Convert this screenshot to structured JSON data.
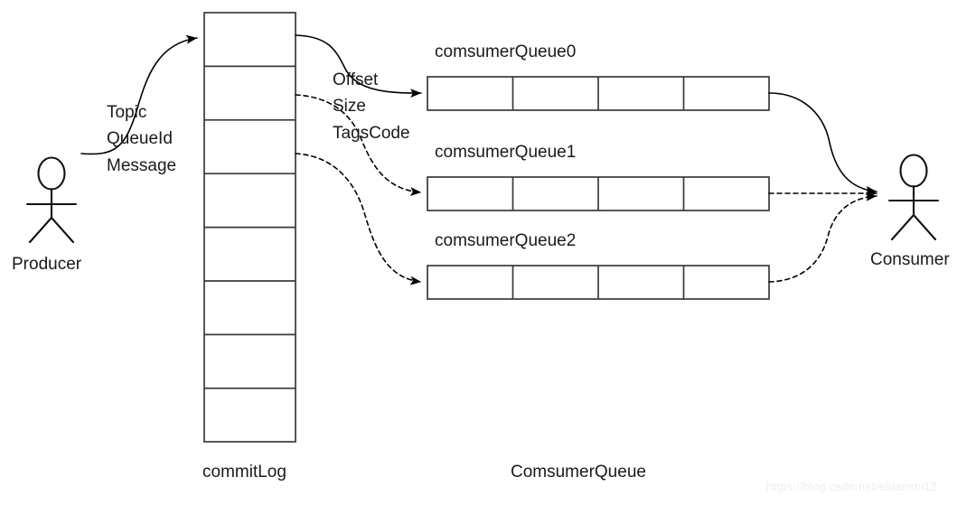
{
  "diagram": {
    "producer": {
      "label": "Producer",
      "icon": "stick-figure-person-icon"
    },
    "consumer": {
      "label": "Consumer",
      "icon": "stick-figure-person-icon"
    },
    "producer_message_fields": [
      "Topic",
      "QueueId",
      "Message"
    ],
    "dispatch_fields": [
      "Offset",
      "Size",
      "TagsCode"
    ],
    "commit_log": {
      "caption": "commitLog",
      "cell_count": 8,
      "cells": [
        "",
        "",
        "",
        "",
        "",
        "",
        "",
        ""
      ]
    },
    "consumer_queue_group": {
      "caption": "ComsumerQueue",
      "queues": [
        {
          "title": "comsumerQueue0",
          "cell_count": 4,
          "cells": [
            "",
            "",
            "",
            ""
          ],
          "inbound_style": "solid",
          "outbound_style": "solid"
        },
        {
          "title": "comsumerQueue1",
          "cell_count": 4,
          "cells": [
            "",
            "",
            "",
            ""
          ],
          "inbound_style": "dashed",
          "outbound_style": "dashed"
        },
        {
          "title": "comsumerQueue2",
          "cell_count": 4,
          "cells": [
            "",
            "",
            "",
            ""
          ],
          "inbound_style": "dashed",
          "outbound_style": "dashed"
        }
      ]
    },
    "arrows": [
      {
        "name": "producer-to-commitlog",
        "style": "solid"
      },
      {
        "name": "commitlog-to-queue0",
        "style": "solid"
      },
      {
        "name": "commitlog-to-queue1",
        "style": "dashed"
      },
      {
        "name": "commitlog-to-queue2",
        "style": "dashed"
      },
      {
        "name": "queue0-to-consumer",
        "style": "solid"
      },
      {
        "name": "queue1-to-consumer",
        "style": "dashed"
      },
      {
        "name": "queue2-to-consumer",
        "style": "dashed"
      }
    ],
    "watermark": "https://blog.csdn.net/eluanshi12",
    "colors": {
      "background": "#ffffff",
      "stroke": "#000000",
      "box_stroke": "#3a3a3a",
      "text": "#1a1a1a",
      "watermark": "#eceef0"
    }
  }
}
